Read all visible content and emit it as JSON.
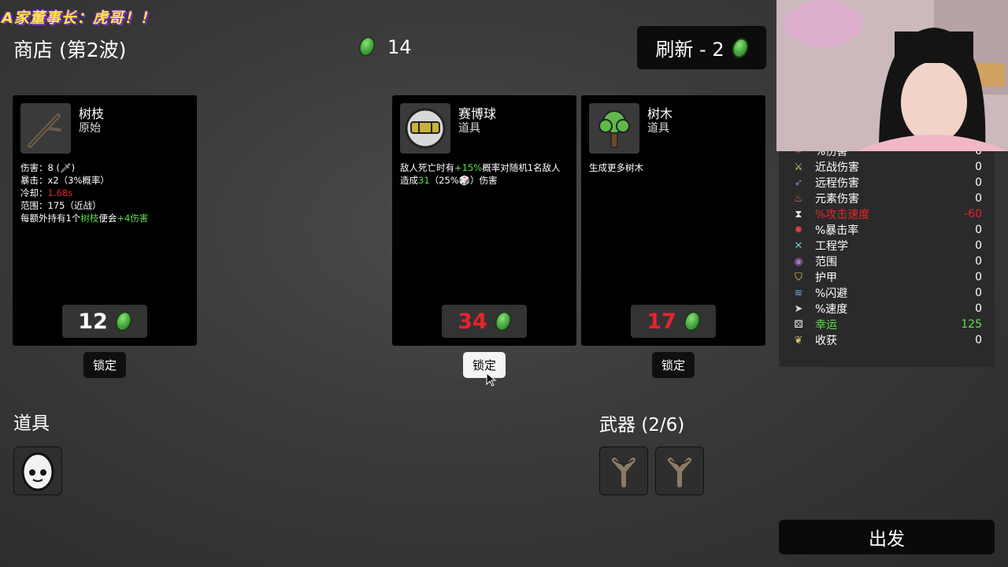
{
  "banner": "A家董事长：虎哥！！",
  "shop": {
    "title": "商店 (第2波)",
    "coins": "14"
  },
  "refresh": {
    "label": "刷新 - 2"
  },
  "cards": [
    {
      "name": "树枝",
      "type": "原始",
      "lines": {
        "damage": "伤害：8 (",
        "crit": "暴击：x2（3%概率）",
        "cooldown_label": "冷却：",
        "cooldown_value": "1.68s",
        "range": "范围：175（近战）",
        "bonus_a": "每额外持有1个",
        "bonus_b": "树枝",
        "bonus_c": "便会",
        "bonus_d": "+4伤害"
      },
      "price": "12",
      "lock": "锁定"
    },
    {
      "name": "赛博球",
      "type": "道具",
      "lines": {
        "a": "敌人死亡时有",
        "b": "+15%",
        "c": "概率对随机1名敌人",
        "d": "造成",
        "e": "31",
        "f": "（25%",
        "g": "）伤害"
      },
      "price": "34",
      "lock": "锁定"
    },
    {
      "name": "树木",
      "type": "道具",
      "lines": {
        "a": "生成更多树木"
      },
      "price": "17",
      "lock": "锁定"
    }
  ],
  "items_section": {
    "title": "道具"
  },
  "weapons_section": {
    "title": "武器 (2/6)"
  },
  "stats": [
    {
      "label": "%伤害",
      "value": "0",
      "icon": "damage-icon",
      "color": "#ffffff"
    },
    {
      "label": "近战伤害",
      "value": "0",
      "icon": "sword-icon",
      "color": "#ffffff"
    },
    {
      "label": "远程伤害",
      "value": "0",
      "icon": "bow-icon",
      "color": "#ffffff"
    },
    {
      "label": "元素伤害",
      "value": "0",
      "icon": "flame-icon",
      "color": "#ffffff"
    },
    {
      "label": "%攻击速度",
      "value": "-60",
      "icon": "hourglass-icon",
      "color": "#e8232e"
    },
    {
      "label": "%暴击率",
      "value": "0",
      "icon": "crit-icon",
      "color": "#ffffff"
    },
    {
      "label": "工程学",
      "value": "0",
      "icon": "wrench-icon",
      "color": "#ffffff"
    },
    {
      "label": "范围",
      "value": "0",
      "icon": "range-icon",
      "color": "#ffffff"
    },
    {
      "label": "护甲",
      "value": "0",
      "icon": "shield-icon",
      "color": "#ffffff"
    },
    {
      "label": "%闪避",
      "value": "0",
      "icon": "dodge-icon",
      "color": "#ffffff"
    },
    {
      "label": "%速度",
      "value": "0",
      "icon": "boot-icon",
      "color": "#ffffff"
    },
    {
      "label": "幸运",
      "value": "125",
      "icon": "dice-icon",
      "color": "#5de04a"
    },
    {
      "label": "收获",
      "value": "0",
      "icon": "wheat-icon",
      "color": "#ffffff"
    }
  ],
  "go": {
    "label": "出发"
  }
}
